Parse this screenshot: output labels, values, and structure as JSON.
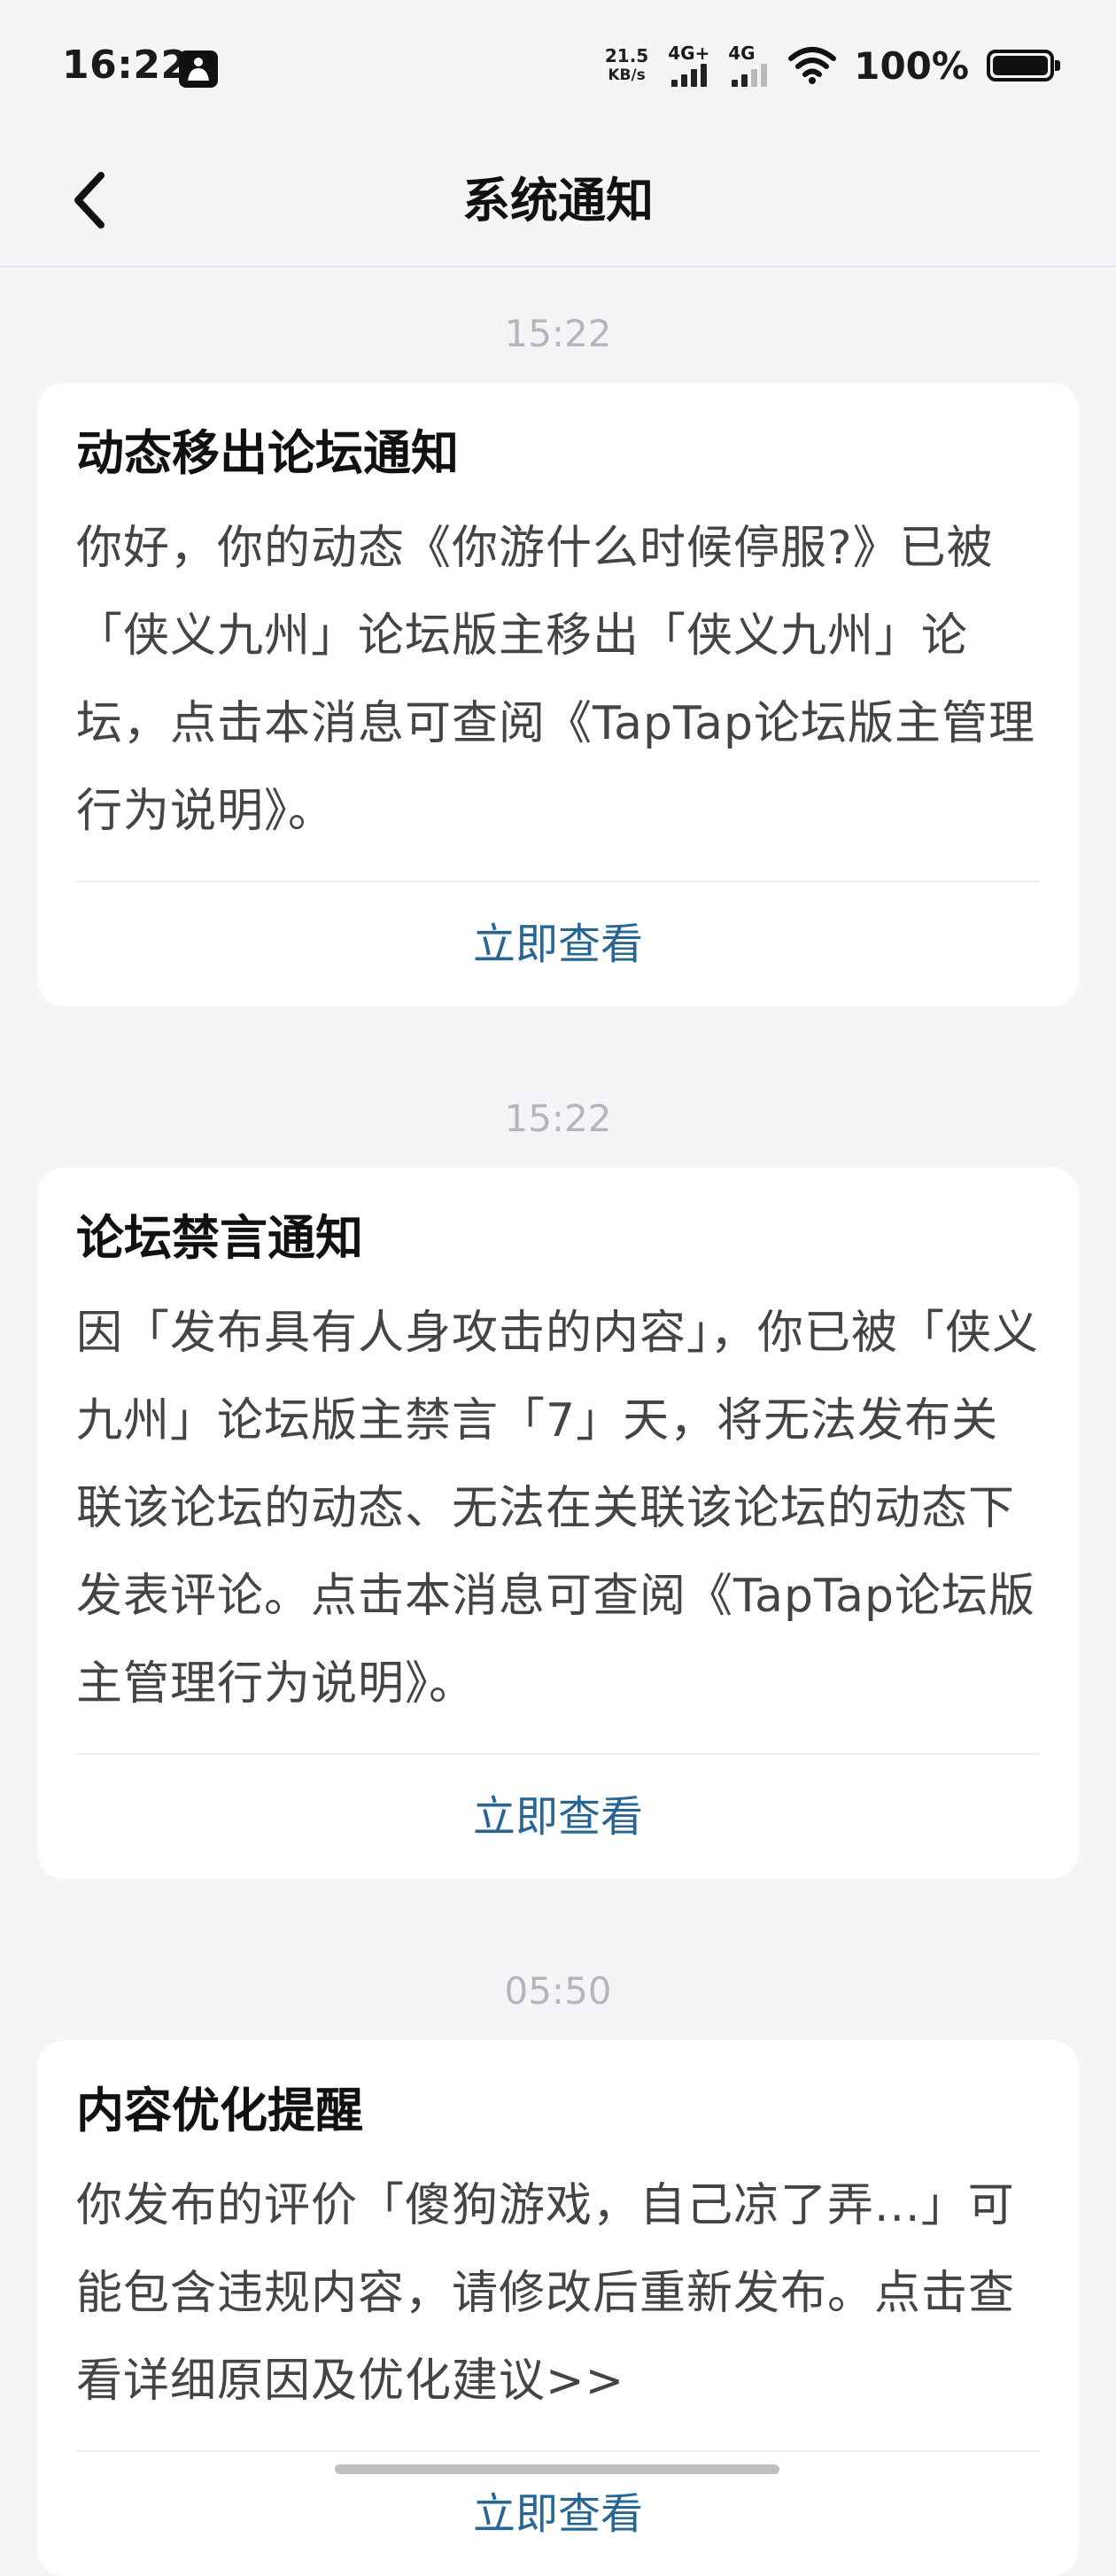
{
  "status_bar": {
    "time": "16:22",
    "net_speed_value": "21.5",
    "net_speed_unit": "KB/s",
    "signal1_label": "4G+",
    "signal2_label": "4G",
    "battery": "100%"
  },
  "header": {
    "title": "系统通知"
  },
  "notifications": [
    {
      "time": "15:22",
      "title": "动态移出论坛通知",
      "body": "你好，你的动态《你游什么时候停服?》已被「侠义九州」论坛版主移出「侠义九州」论坛，点击本消息可查阅《TapTap论坛版主管理行为说明》。",
      "action": "立即查看"
    },
    {
      "time": "15:22",
      "title": "论坛禁言通知",
      "body": "因「发布具有人身攻击的内容」，你已被「侠义九州」论坛版主禁言「7」天，将无法发布关联该论坛的动态、无法在关联该论坛的动态下发表评论。点击本消息可查阅《TapTap论坛版主管理行为说明》。",
      "action": "立即查看"
    },
    {
      "time": "05:50",
      "title": "内容优化提醒",
      "body": "你发布的评价「傻狗游戏，自己凉了弄...」可能包含违规内容，请修改后重新发布。点击查看详细原因及优化建议>>",
      "action": "立即查看"
    }
  ],
  "colors": {
    "accent": "#276592",
    "background": "#f4f5f7",
    "timestamp": "#b4b6bb"
  }
}
